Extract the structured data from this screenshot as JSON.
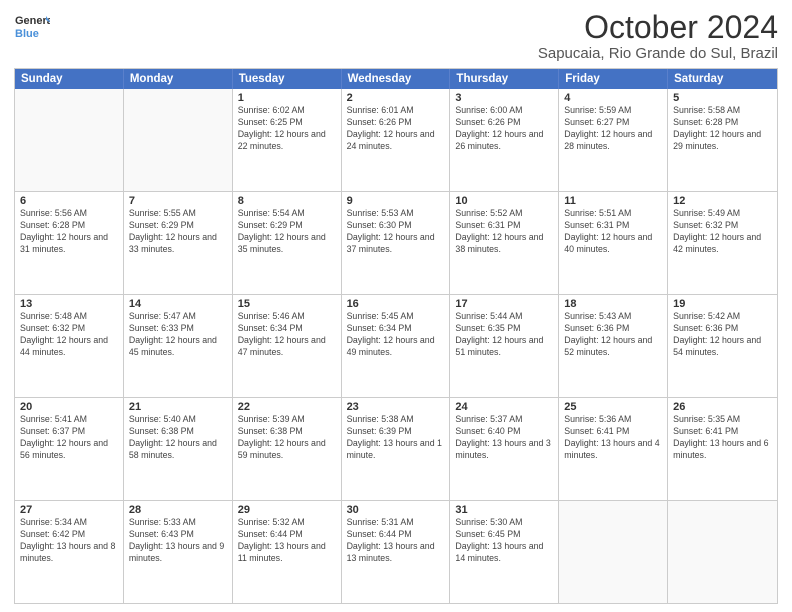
{
  "logo": {
    "general": "General",
    "blue": "Blue"
  },
  "title": "October 2024",
  "location": "Sapucaia, Rio Grande do Sul, Brazil",
  "days": [
    "Sunday",
    "Monday",
    "Tuesday",
    "Wednesday",
    "Thursday",
    "Friday",
    "Saturday"
  ],
  "weeks": [
    [
      {
        "day": "",
        "info": ""
      },
      {
        "day": "",
        "info": ""
      },
      {
        "day": "1",
        "info": "Sunrise: 6:02 AM\nSunset: 6:25 PM\nDaylight: 12 hours and 22 minutes."
      },
      {
        "day": "2",
        "info": "Sunrise: 6:01 AM\nSunset: 6:26 PM\nDaylight: 12 hours and 24 minutes."
      },
      {
        "day": "3",
        "info": "Sunrise: 6:00 AM\nSunset: 6:26 PM\nDaylight: 12 hours and 26 minutes."
      },
      {
        "day": "4",
        "info": "Sunrise: 5:59 AM\nSunset: 6:27 PM\nDaylight: 12 hours and 28 minutes."
      },
      {
        "day": "5",
        "info": "Sunrise: 5:58 AM\nSunset: 6:28 PM\nDaylight: 12 hours and 29 minutes."
      }
    ],
    [
      {
        "day": "6",
        "info": "Sunrise: 5:56 AM\nSunset: 6:28 PM\nDaylight: 12 hours and 31 minutes."
      },
      {
        "day": "7",
        "info": "Sunrise: 5:55 AM\nSunset: 6:29 PM\nDaylight: 12 hours and 33 minutes."
      },
      {
        "day": "8",
        "info": "Sunrise: 5:54 AM\nSunset: 6:29 PM\nDaylight: 12 hours and 35 minutes."
      },
      {
        "day": "9",
        "info": "Sunrise: 5:53 AM\nSunset: 6:30 PM\nDaylight: 12 hours and 37 minutes."
      },
      {
        "day": "10",
        "info": "Sunrise: 5:52 AM\nSunset: 6:31 PM\nDaylight: 12 hours and 38 minutes."
      },
      {
        "day": "11",
        "info": "Sunrise: 5:51 AM\nSunset: 6:31 PM\nDaylight: 12 hours and 40 minutes."
      },
      {
        "day": "12",
        "info": "Sunrise: 5:49 AM\nSunset: 6:32 PM\nDaylight: 12 hours and 42 minutes."
      }
    ],
    [
      {
        "day": "13",
        "info": "Sunrise: 5:48 AM\nSunset: 6:32 PM\nDaylight: 12 hours and 44 minutes."
      },
      {
        "day": "14",
        "info": "Sunrise: 5:47 AM\nSunset: 6:33 PM\nDaylight: 12 hours and 45 minutes."
      },
      {
        "day": "15",
        "info": "Sunrise: 5:46 AM\nSunset: 6:34 PM\nDaylight: 12 hours and 47 minutes."
      },
      {
        "day": "16",
        "info": "Sunrise: 5:45 AM\nSunset: 6:34 PM\nDaylight: 12 hours and 49 minutes."
      },
      {
        "day": "17",
        "info": "Sunrise: 5:44 AM\nSunset: 6:35 PM\nDaylight: 12 hours and 51 minutes."
      },
      {
        "day": "18",
        "info": "Sunrise: 5:43 AM\nSunset: 6:36 PM\nDaylight: 12 hours and 52 minutes."
      },
      {
        "day": "19",
        "info": "Sunrise: 5:42 AM\nSunset: 6:36 PM\nDaylight: 12 hours and 54 minutes."
      }
    ],
    [
      {
        "day": "20",
        "info": "Sunrise: 5:41 AM\nSunset: 6:37 PM\nDaylight: 12 hours and 56 minutes."
      },
      {
        "day": "21",
        "info": "Sunrise: 5:40 AM\nSunset: 6:38 PM\nDaylight: 12 hours and 58 minutes."
      },
      {
        "day": "22",
        "info": "Sunrise: 5:39 AM\nSunset: 6:38 PM\nDaylight: 12 hours and 59 minutes."
      },
      {
        "day": "23",
        "info": "Sunrise: 5:38 AM\nSunset: 6:39 PM\nDaylight: 13 hours and 1 minute."
      },
      {
        "day": "24",
        "info": "Sunrise: 5:37 AM\nSunset: 6:40 PM\nDaylight: 13 hours and 3 minutes."
      },
      {
        "day": "25",
        "info": "Sunrise: 5:36 AM\nSunset: 6:41 PM\nDaylight: 13 hours and 4 minutes."
      },
      {
        "day": "26",
        "info": "Sunrise: 5:35 AM\nSunset: 6:41 PM\nDaylight: 13 hours and 6 minutes."
      }
    ],
    [
      {
        "day": "27",
        "info": "Sunrise: 5:34 AM\nSunset: 6:42 PM\nDaylight: 13 hours and 8 minutes."
      },
      {
        "day": "28",
        "info": "Sunrise: 5:33 AM\nSunset: 6:43 PM\nDaylight: 13 hours and 9 minutes."
      },
      {
        "day": "29",
        "info": "Sunrise: 5:32 AM\nSunset: 6:44 PM\nDaylight: 13 hours and 11 minutes."
      },
      {
        "day": "30",
        "info": "Sunrise: 5:31 AM\nSunset: 6:44 PM\nDaylight: 13 hours and 13 minutes."
      },
      {
        "day": "31",
        "info": "Sunrise: 5:30 AM\nSunset: 6:45 PM\nDaylight: 13 hours and 14 minutes."
      },
      {
        "day": "",
        "info": ""
      },
      {
        "day": "",
        "info": ""
      }
    ]
  ]
}
